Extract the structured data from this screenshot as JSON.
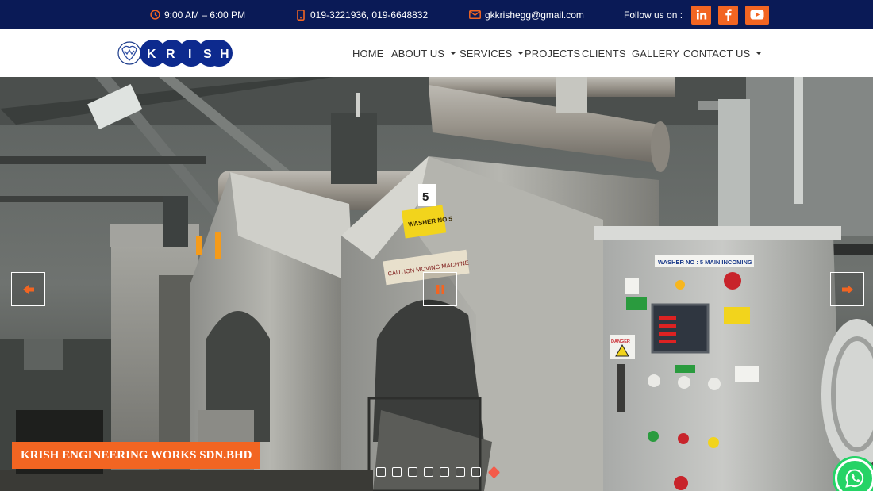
{
  "topbar": {
    "hours": "9:00 AM – 6:00 PM",
    "phones": "019-3221936,  019-6648832",
    "email": "gkkrishegg@gmail.com",
    "follow_label": "Follow us on :",
    "social": [
      {
        "name": "linkedin",
        "label": "in"
      },
      {
        "name": "facebook",
        "label": "f"
      },
      {
        "name": "youtube",
        "label": ""
      }
    ],
    "accent_color": "#f26522",
    "background_color": "#0a1a56"
  },
  "logo": {
    "letters": [
      "K",
      "R",
      "I",
      "S",
      "H"
    ]
  },
  "nav": {
    "items": [
      {
        "label": "HOME",
        "dropdown": false
      },
      {
        "label": "ABOUT US",
        "dropdown": true
      },
      {
        "label": "SERVICES",
        "dropdown": true
      },
      {
        "label": "PROJECTS",
        "dropdown": false
      },
      {
        "label": "CLIENTS",
        "dropdown": false
      },
      {
        "label": "GALLERY",
        "dropdown": false
      },
      {
        "label": "CONTACT US",
        "dropdown": true
      }
    ]
  },
  "hero": {
    "caption": "KRISH ENGINEERING WORKS SDN.BHD",
    "machine_labels": {
      "number": "5",
      "washer_tag": "WASHER NO.5",
      "caution": "CAUTION MOVING MACHINE",
      "panel_tag": "WASHER NO : 5   MAIN INCOMING",
      "danger": "DANGER"
    },
    "slide_count": 8,
    "active_slide": 8,
    "controls": {
      "prev": "previous",
      "pause": "pause",
      "next": "next"
    }
  }
}
